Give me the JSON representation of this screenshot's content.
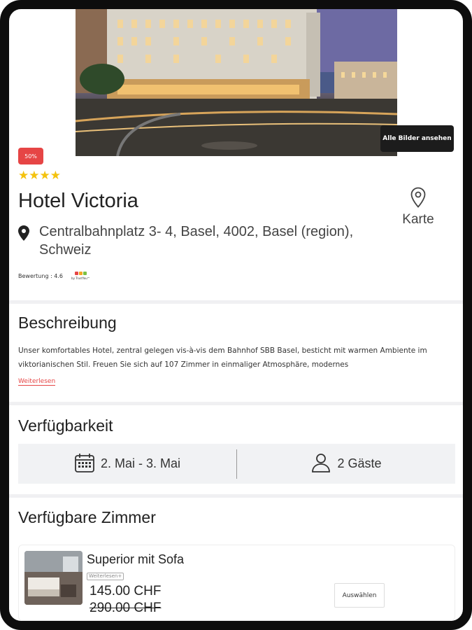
{
  "hero": {
    "all_images_label": "Alle Bilder ansehen"
  },
  "hotel": {
    "discount_badge": "50%",
    "stars": "★★★★",
    "name": "Hotel Victoria",
    "address": "Centralbahnplatz 3- 4, Basel, 4002, Basel (region), Schweiz",
    "map_label": "Karte",
    "rating_text": "Bewertung : 4.6",
    "trustyou_label": "by TrustYou™",
    "trustyou_colors": [
      "#e64545",
      "#f4a623",
      "#7bc043"
    ]
  },
  "description": {
    "title": "Beschreibung",
    "text": "Unser komfortables Hotel, zentral gelegen vis-à-vis dem Bahnhof SBB Basel, besticht mit warmen Ambiente im viktorianischen Stil. Freuen Sie sich auf 107 Zimmer in einmaliger Atmosphäre, modernes",
    "read_more": "Weiterlesen"
  },
  "availability": {
    "title": "Verfügbarkeit",
    "dates": "2. Mai - 3. Mai",
    "guests": "2 Gäste"
  },
  "rooms": {
    "title": "Verfügbare Zimmer",
    "items": [
      {
        "name": "Superior mit Sofa",
        "more_label": "Weiterlesen+",
        "price": "145.00 CHF",
        "old_price": "290.00 CHF",
        "select_label": "Auswählen"
      }
    ]
  },
  "colors": {
    "accent": "#e64545",
    "star": "#f4c20d",
    "availability_bg": "#f1f2f4"
  }
}
